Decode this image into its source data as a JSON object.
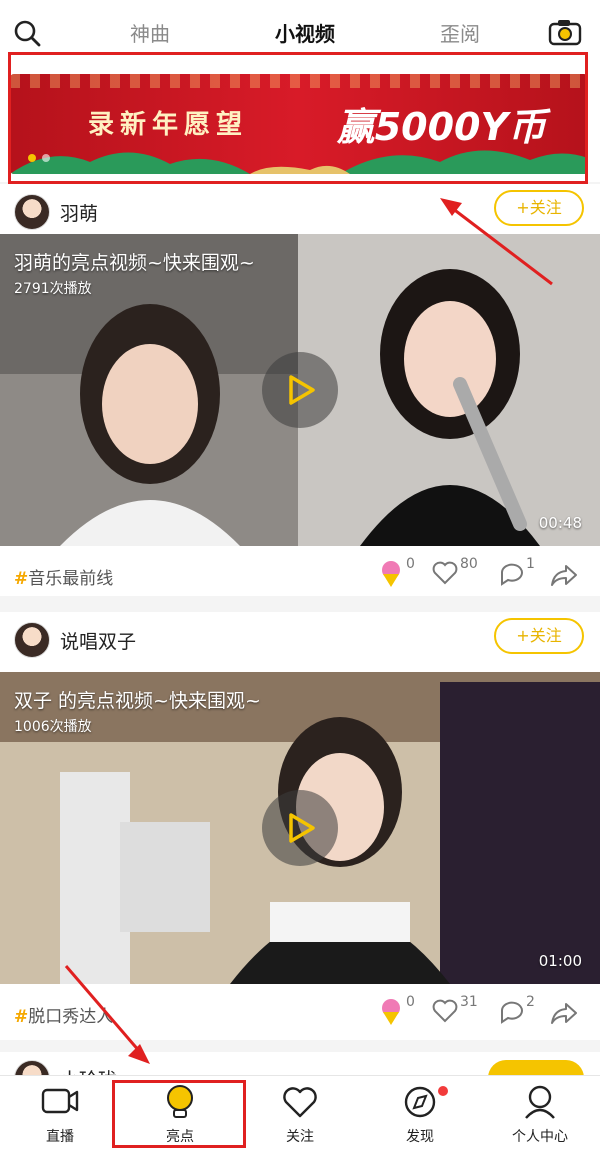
{
  "topnav": {
    "tabs": [
      {
        "label": "神曲",
        "active": false
      },
      {
        "label": "小视频",
        "active": true
      },
      {
        "label": "歪阅",
        "active": false
      }
    ]
  },
  "banner": {
    "left_text": "录新年愿望",
    "right_text": "赢5000Y币",
    "slides": 2,
    "current_slide": 1
  },
  "feed": [
    {
      "author": "羽萌",
      "follow_label": "+关注",
      "video_title": "羽萌的亮点视频~快来围观~",
      "plays": "2791次播放",
      "duration": "00:48",
      "tag": "音乐最前线",
      "gifts": "0",
      "likes": "80",
      "comments": "1"
    },
    {
      "author": "说唱双子",
      "follow_label": "+关注",
      "video_title": "双子 的亮点视频~快来围观~",
      "plays": "1006次播放",
      "duration": "01:00",
      "tag": "脱口秀达人",
      "gifts": "0",
      "likes": "31",
      "comments": "2"
    }
  ],
  "partial_author": "小玲珑",
  "tabbar": {
    "items": [
      {
        "label": "直播",
        "icon": "tv-icon"
      },
      {
        "label": "亮点",
        "icon": "lightbulb-icon"
      },
      {
        "label": "关注",
        "icon": "heart-icon"
      },
      {
        "label": "发现",
        "icon": "compass-icon"
      },
      {
        "label": "个人中心",
        "icon": "person-icon"
      }
    ]
  },
  "colors": {
    "accent": "#f5c400",
    "banner_red": "#d81b28",
    "highlight": "#e02020"
  }
}
